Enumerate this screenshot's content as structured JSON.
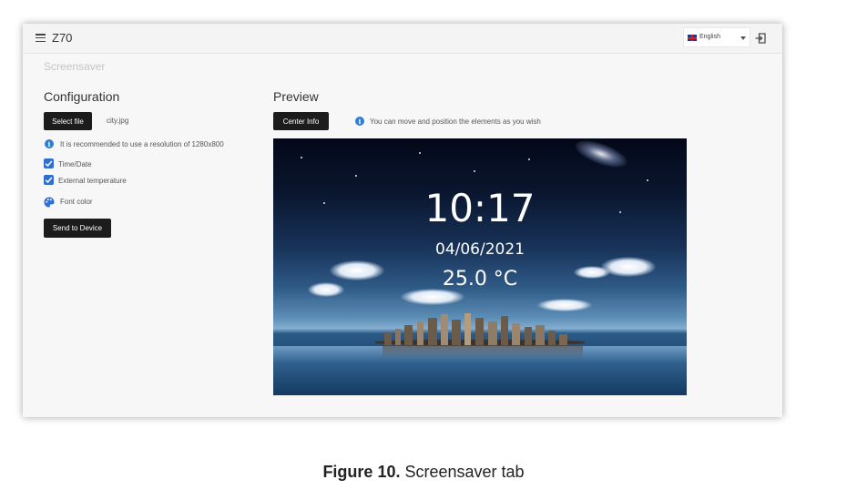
{
  "header": {
    "app_title": "Z70",
    "language": "English",
    "menu_icon": "hamburger-icon",
    "logout_icon": "logout-icon"
  },
  "section_label": "Screensaver",
  "configuration": {
    "title": "Configuration",
    "select_file_label": "Select file",
    "file_name": "city.jpg",
    "resolution_hint": "It is recommended to use a resolution of 1280x800",
    "checkboxes": [
      {
        "label": "Time/Date",
        "checked": true
      },
      {
        "label": "External temperature",
        "checked": true
      }
    ],
    "font_color_label": "Font color",
    "send_button_label": "Send to Device"
  },
  "preview": {
    "title": "Preview",
    "center_button_label": "Center Info",
    "hint": "You can move and position the elements as you wish",
    "time": "10:17",
    "date": "04/06/2021",
    "temperature": "25.0 °C"
  },
  "caption": {
    "figure": "Figure 10.",
    "text": " Screensaver tab"
  },
  "colors": {
    "accent_blue": "#2f6fd0",
    "button_dark": "#1c1c1c"
  }
}
